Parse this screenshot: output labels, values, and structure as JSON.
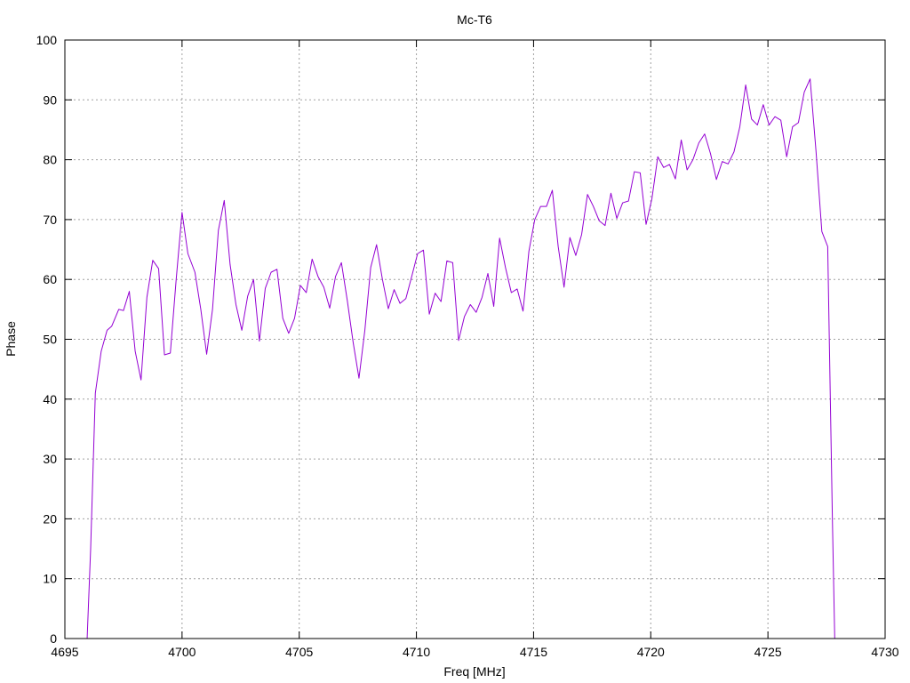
{
  "chart_data": {
    "type": "line",
    "title": "Mc-T6",
    "xlabel": "Freq [MHz]",
    "ylabel": "Phase",
    "xlim": [
      4695,
      4730
    ],
    "ylim": [
      0,
      100
    ],
    "xticks": [
      4695,
      4700,
      4705,
      4710,
      4715,
      4720,
      4725,
      4730
    ],
    "yticks": [
      0,
      10,
      20,
      30,
      40,
      50,
      60,
      70,
      80,
      90,
      100
    ],
    "grid": true,
    "series": [
      {
        "color": "#9400d3",
        "points": [
          [
            4695.95,
            0
          ],
          [
            4696.1,
            15
          ],
          [
            4696.3,
            41
          ],
          [
            4696.55,
            48
          ],
          [
            4696.8,
            51.5
          ],
          [
            4697.0,
            52.2
          ],
          [
            4697.3,
            55
          ],
          [
            4697.5,
            54.8
          ],
          [
            4697.75,
            58
          ],
          [
            4698.0,
            48
          ],
          [
            4698.25,
            43.2
          ],
          [
            4698.5,
            57
          ],
          [
            4698.75,
            63.2
          ],
          [
            4699.0,
            61.8
          ],
          [
            4699.25,
            47.4
          ],
          [
            4699.5,
            47.7
          ],
          [
            4699.75,
            60
          ],
          [
            4700.0,
            71.2
          ],
          [
            4700.25,
            64.3
          ],
          [
            4700.55,
            61.2
          ],
          [
            4700.8,
            55
          ],
          [
            4701.05,
            47.5
          ],
          [
            4701.3,
            55
          ],
          [
            4701.55,
            68.2
          ],
          [
            4701.8,
            73.2
          ],
          [
            4702.05,
            62.5
          ],
          [
            4702.3,
            55.8
          ],
          [
            4702.55,
            51.5
          ],
          [
            4702.8,
            57.2
          ],
          [
            4703.05,
            60
          ],
          [
            4703.3,
            49.7
          ],
          [
            4703.55,
            58.5
          ],
          [
            4703.8,
            61.2
          ],
          [
            4704.05,
            61.7
          ],
          [
            4704.3,
            53.5
          ],
          [
            4704.55,
            51
          ],
          [
            4704.8,
            53.5
          ],
          [
            4705.05,
            59
          ],
          [
            4705.3,
            57.8
          ],
          [
            4705.55,
            63.4
          ],
          [
            4705.8,
            60.5
          ],
          [
            4706.05,
            58.7
          ],
          [
            4706.3,
            55.2
          ],
          [
            4706.55,
            60.5
          ],
          [
            4706.8,
            62.8
          ],
          [
            4707.05,
            56.5
          ],
          [
            4707.3,
            49.5
          ],
          [
            4707.55,
            43.5
          ],
          [
            4707.8,
            51.5
          ],
          [
            4708.05,
            62
          ],
          [
            4708.3,
            65.8
          ],
          [
            4708.55,
            60
          ],
          [
            4708.8,
            55.1
          ],
          [
            4709.05,
            58.3
          ],
          [
            4709.3,
            56
          ],
          [
            4709.55,
            56.8
          ],
          [
            4709.8,
            60.5
          ],
          [
            4710.05,
            64.3
          ],
          [
            4710.3,
            64.9
          ],
          [
            4710.55,
            54.2
          ],
          [
            4710.8,
            57.7
          ],
          [
            4711.05,
            56.3
          ],
          [
            4711.3,
            63.1
          ],
          [
            4711.55,
            62.8
          ],
          [
            4711.8,
            49.8
          ],
          [
            4712.05,
            53.8
          ],
          [
            4712.3,
            55.8
          ],
          [
            4712.55,
            54.5
          ],
          [
            4712.8,
            57
          ],
          [
            4713.05,
            61
          ],
          [
            4713.3,
            55.5
          ],
          [
            4713.55,
            66.9
          ],
          [
            4713.8,
            62
          ],
          [
            4714.05,
            57.8
          ],
          [
            4714.3,
            58.4
          ],
          [
            4714.55,
            54.7
          ],
          [
            4714.8,
            64.7
          ],
          [
            4715.05,
            70
          ],
          [
            4715.3,
            72.2
          ],
          [
            4715.55,
            72.2
          ],
          [
            4715.8,
            74.9
          ],
          [
            4716.05,
            65.5
          ],
          [
            4716.3,
            58.7
          ],
          [
            4716.55,
            67
          ],
          [
            4716.8,
            64
          ],
          [
            4717.05,
            67.5
          ],
          [
            4717.3,
            74.2
          ],
          [
            4717.55,
            72.2
          ],
          [
            4717.8,
            69.8
          ],
          [
            4718.05,
            69
          ],
          [
            4718.3,
            74.4
          ],
          [
            4718.55,
            70.2
          ],
          [
            4718.8,
            72.8
          ],
          [
            4719.05,
            73.1
          ],
          [
            4719.3,
            78
          ],
          [
            4719.55,
            77.8
          ],
          [
            4719.8,
            69.2
          ],
          [
            4720.05,
            73.5
          ],
          [
            4720.3,
            80.5
          ],
          [
            4720.55,
            78.7
          ],
          [
            4720.8,
            79.2
          ],
          [
            4721.05,
            76.8
          ],
          [
            4721.3,
            83.3
          ],
          [
            4721.55,
            78.3
          ],
          [
            4721.8,
            80
          ],
          [
            4722.05,
            82.8
          ],
          [
            4722.3,
            84.3
          ],
          [
            4722.55,
            81
          ],
          [
            4722.8,
            76.7
          ],
          [
            4723.05,
            79.7
          ],
          [
            4723.3,
            79.3
          ],
          [
            4723.55,
            81.3
          ],
          [
            4723.8,
            85.5
          ],
          [
            4724.05,
            92.5
          ],
          [
            4724.3,
            86.8
          ],
          [
            4724.55,
            85.8
          ],
          [
            4724.8,
            89.2
          ],
          [
            4725.05,
            85.8
          ],
          [
            4725.3,
            87.2
          ],
          [
            4725.55,
            86.6
          ],
          [
            4725.8,
            80.5
          ],
          [
            4726.05,
            85.5
          ],
          [
            4726.3,
            86.2
          ],
          [
            4726.55,
            91.3
          ],
          [
            4726.8,
            93.5
          ],
          [
            4727.05,
            81.5
          ],
          [
            4727.3,
            68
          ],
          [
            4727.55,
            65.5
          ],
          [
            4727.75,
            20
          ],
          [
            4727.85,
            0
          ]
        ]
      }
    ]
  }
}
